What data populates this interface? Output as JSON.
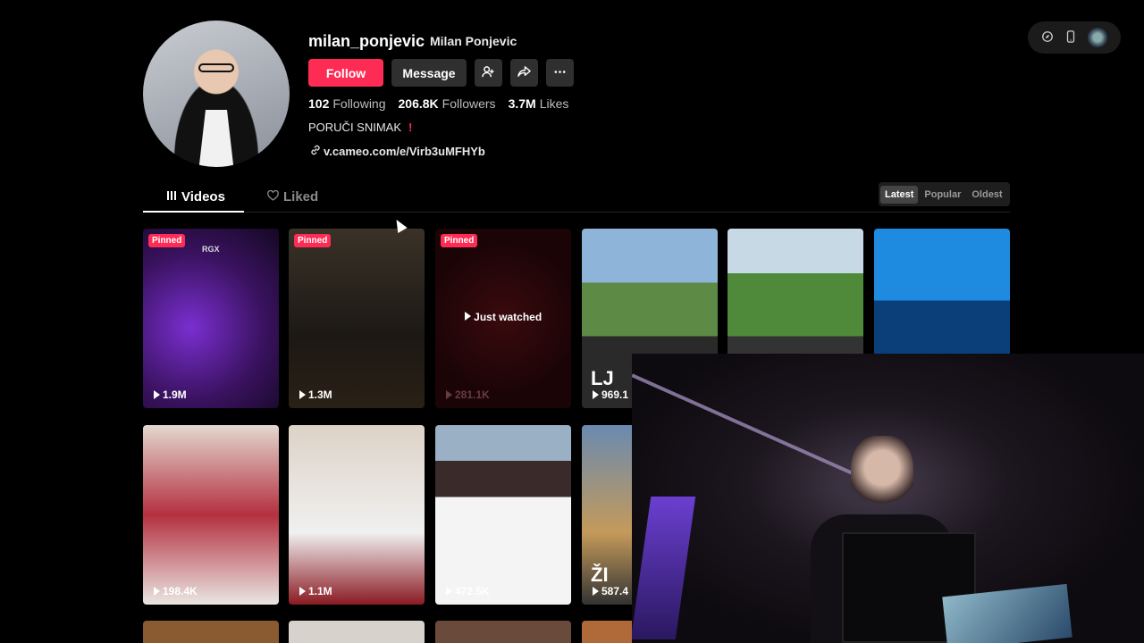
{
  "profile": {
    "username": "milan_ponjevic",
    "nickname": "Milan Ponjevic",
    "follow_label": "Follow",
    "message_label": "Message",
    "stats": {
      "following": "102",
      "following_label": "Following",
      "followers": "206.8K",
      "followers_label": "Followers",
      "likes": "3.7M",
      "likes_label": "Likes"
    },
    "bio": "PORUČI SNIMAK",
    "bio_mark": "!",
    "link": "v.cameo.com/e/Virb3uMFHYb"
  },
  "tabs": {
    "videos": "Videos",
    "liked": "Liked"
  },
  "sort": {
    "latest": "Latest",
    "popular": "Popular",
    "oldest": "Oldest"
  },
  "videos": [
    {
      "pinned": "Pinned",
      "views": "1.9M",
      "overlay": "RGX"
    },
    {
      "pinned": "Pinned",
      "views": "1.3M"
    },
    {
      "pinned": "Pinned",
      "views": "281.1K",
      "status": "Just watched"
    },
    {
      "views": "969.1",
      "overlay": "LJ"
    },
    {
      "views": ""
    },
    {
      "views": ""
    },
    {
      "views": "198.4K"
    },
    {
      "views": "1.1M"
    },
    {
      "views": "472.5K"
    },
    {
      "views": "587.4",
      "overlay": "ŽI"
    }
  ],
  "icons": {
    "add_user": "add-user-icon",
    "share": "share-icon",
    "more": "more-icon",
    "link": "link-icon",
    "grid": "grid-icon",
    "heart": "heart-icon",
    "compass": "compass-icon",
    "phone": "phone-icon"
  },
  "colors": {
    "accent": "#fe2c55",
    "background": "#000000"
  }
}
